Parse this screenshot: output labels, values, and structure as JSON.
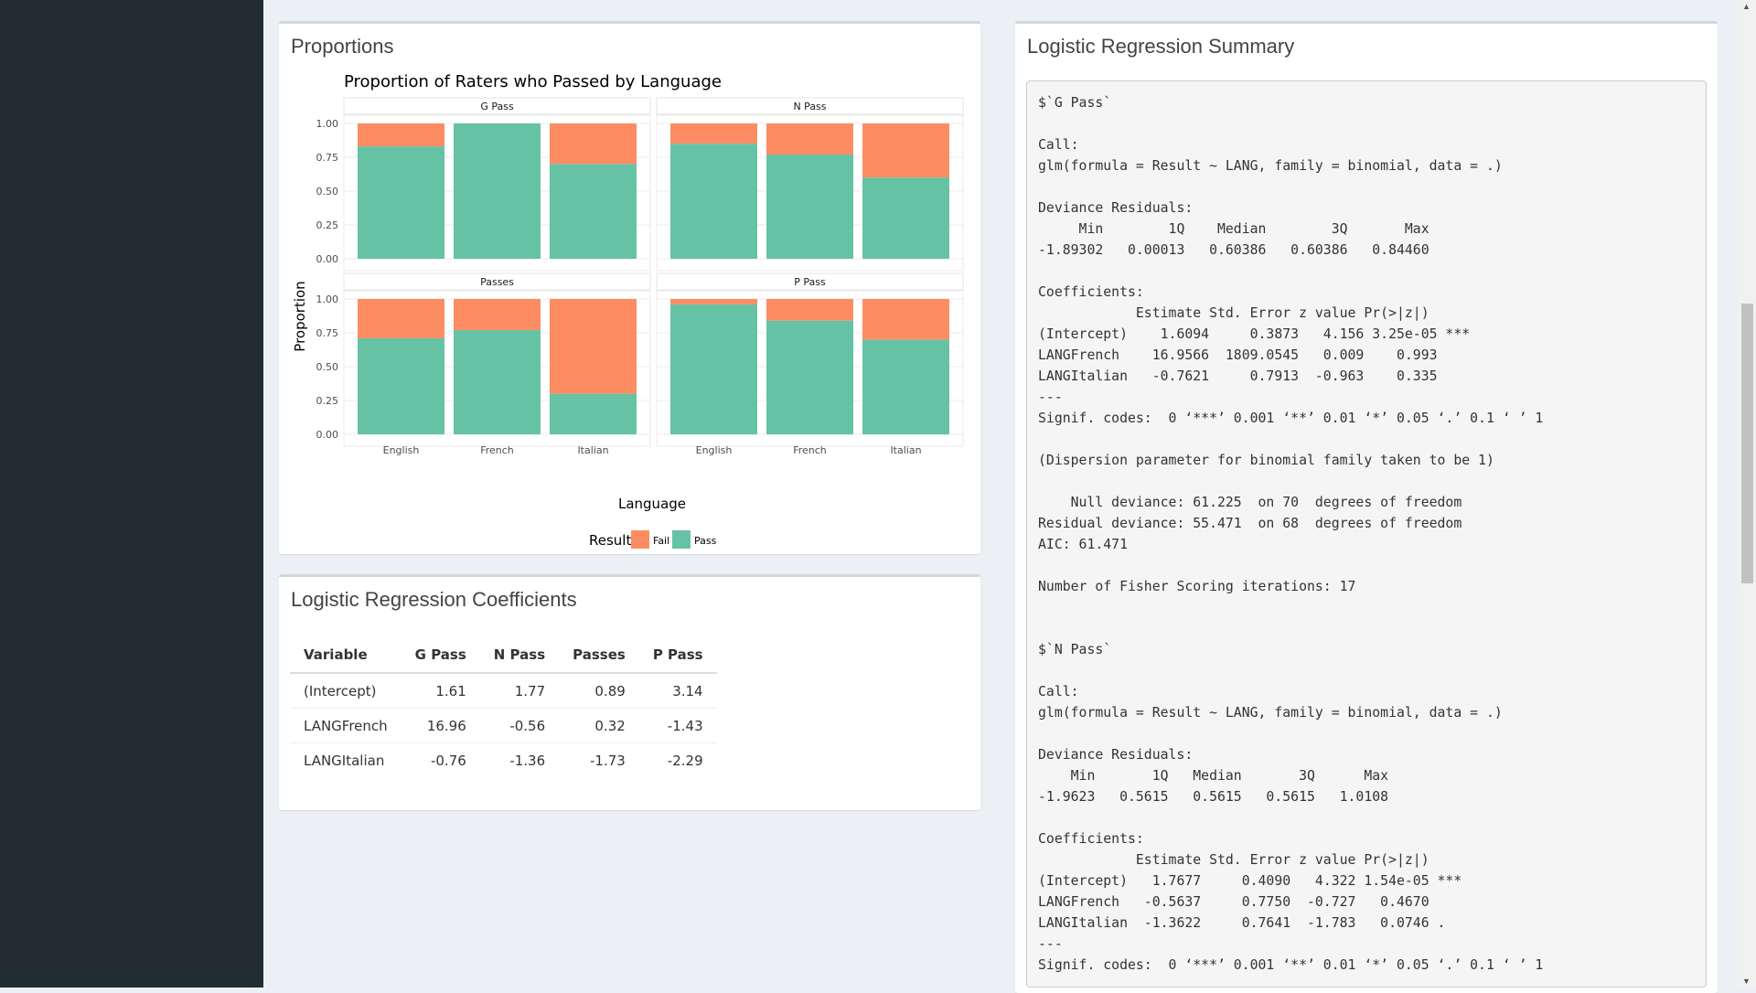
{
  "proportions": {
    "title": "Proportions",
    "chart_data": {
      "type": "bar",
      "title": "Proportion of Raters who Passed by Language",
      "xlabel": "Language",
      "ylabel": "Proportion",
      "ylim": [
        0,
        1
      ],
      "yticks": [
        "0.00",
        "0.25",
        "0.50",
        "0.75",
        "1.00"
      ],
      "categories": [
        "English",
        "French",
        "Italian"
      ],
      "legend": {
        "title": "Result",
        "items": [
          "Fail",
          "Pass"
        ],
        "position": "bottom"
      },
      "colors": {
        "Fail": "#fc8d62",
        "Pass": "#66c2a5"
      },
      "facets": [
        {
          "name": "G Pass",
          "pass": [
            0.83,
            1.0,
            0.7
          ]
        },
        {
          "name": "N Pass",
          "pass": [
            0.85,
            0.77,
            0.6
          ]
        },
        {
          "name": "Passes",
          "pass": [
            0.71,
            0.77,
            0.3
          ]
        },
        {
          "name": "P Pass",
          "pass": [
            0.96,
            0.84,
            0.7
          ]
        }
      ]
    }
  },
  "coefficients": {
    "title": "Logistic Regression Coefficients",
    "headers": [
      "Variable",
      "G Pass",
      "N Pass",
      "Passes",
      "P Pass"
    ],
    "rows": [
      [
        "(Intercept)",
        "1.61",
        "1.77",
        "0.89",
        "3.14"
      ],
      [
        "LANGFrench",
        "16.96",
        "-0.56",
        "0.32",
        "-1.43"
      ],
      [
        "LANGItalian",
        "-0.76",
        "-1.36",
        "-1.73",
        "-2.29"
      ]
    ]
  },
  "summary": {
    "title": "Logistic Regression Summary",
    "text": "$`G Pass`\n\nCall:\nglm(formula = Result ~ LANG, family = binomial, data = .)\n\nDeviance Residuals: \n     Min        1Q    Median        3Q       Max  \n-1.89302   0.00013   0.60386   0.60386   0.84460  \n\nCoefficients:\n            Estimate Std. Error z value Pr(>|z|)    \n(Intercept)    1.6094     0.3873   4.156 3.25e-05 ***\nLANGFrench    16.9566  1809.0545   0.009    0.993    \nLANGItalian   -0.7621     0.7913  -0.963    0.335    \n---\nSignif. codes:  0 ‘***’ 0.001 ‘**’ 0.01 ‘*’ 0.05 ‘.’ 0.1 ‘ ’ 1\n\n(Dispersion parameter for binomial family taken to be 1)\n\n    Null deviance: 61.225  on 70  degrees of freedom\nResidual deviance: 55.471  on 68  degrees of freedom\nAIC: 61.471\n\nNumber of Fisher Scoring iterations: 17\n\n\n$`N Pass`\n\nCall:\nglm(formula = Result ~ LANG, family = binomial, data = .)\n\nDeviance Residuals: \n    Min       1Q   Median       3Q      Max  \n-1.9623   0.5615   0.5615   0.5615   1.0108  \n\nCoefficients:\n            Estimate Std. Error z value Pr(>|z|)    \n(Intercept)   1.7677     0.4090   4.322 1.54e-05 ***\nLANGFrench   -0.5637     0.7750  -0.727   0.4670    \nLANGItalian  -1.3622     0.7641  -1.783   0.0746 .  \n---\nSignif. codes:  0 ‘***’ 0.001 ‘**’ 0.01 ‘*’ 0.05 ‘.’ 0.1 ‘ ’ 1"
  }
}
